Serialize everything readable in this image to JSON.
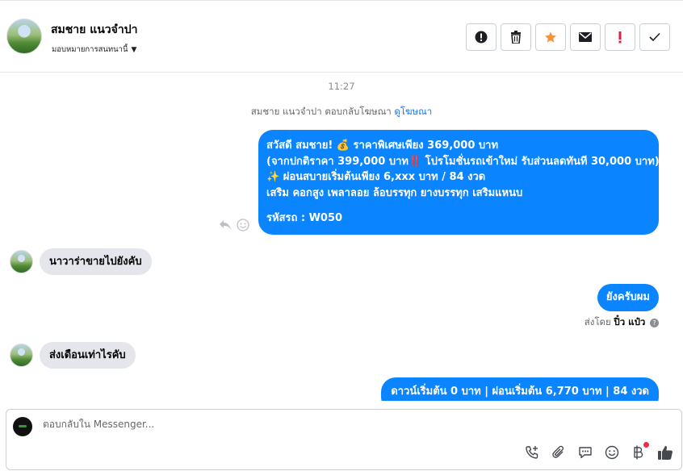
{
  "header": {
    "contact_name": "สมชาย แนวจำปา",
    "assign_label": "มอบหมายการสนทนานี้",
    "actions": {
      "spam_icon": "exclamation-circle-icon",
      "delete_icon": "trash-icon",
      "star_icon": "star-icon",
      "mail_icon": "envelope-icon",
      "flag_icon": "exclamation-icon",
      "done_icon": "check-icon"
    }
  },
  "thread": {
    "timestamp": "11:27",
    "replied_prefix": "สมชาย แนวจำปา ตอบกลับโฆษณา",
    "replied_link": "ดูโฆษณา",
    "ad_message": {
      "line1": "สวัสดี สมชาย! 💰 ราคาพิเศษเพียง 369,000 บาท",
      "line2": "(จากปกติราคา 399,000 บาท‼️ โปรโมชั่นรถเข้าใหม่ รับส่วนลดทันที 30,000 บาท)",
      "line3": "✨ ผ่อนสบายเริ่มต้นเพียง 6,xxx บาท / 84 งวด",
      "line4": "เสริม คอกสูง เพลาลอย ล้อบรรทุก ยางบรรทุก เสริมแหนบ",
      "code": "รหัสรถ : W050"
    },
    "incoming_1": "นาวาร่าขายไปยังคับ",
    "outgoing_1": "ยังครับผม",
    "sent_by_prefix": "ส่งโดย",
    "sent_by_name": "ปิ๋ว แป๋ว",
    "incoming_2": "ส่งเดือนเท่าไรคับ",
    "outgoing_2": "ดาวน์เริ่มต้น 0 บาท | ผ่อนเริ่มต้น 6,770 บาท | 84 งวด"
  },
  "composer": {
    "placeholder": "ตอบกลับใน Messenger..."
  },
  "colors": {
    "accent": "#0a84ff",
    "incoming_bubble": "#e4e6eb",
    "star": "#f7923b",
    "alert": "#e41e3f"
  }
}
